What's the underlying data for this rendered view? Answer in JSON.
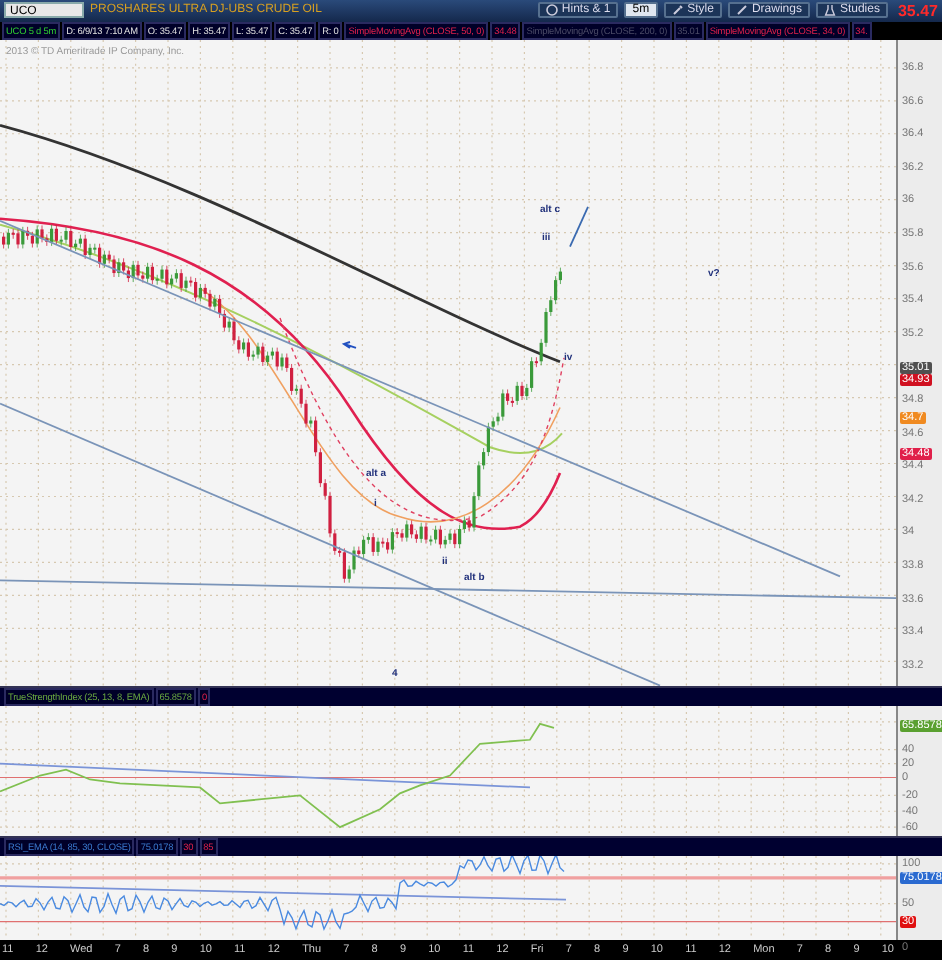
{
  "toolbar": {
    "symbol": "UCO",
    "description": "PROSHARES ULTRA DJ-UBS CRUDE OIL",
    "buttons": [
      {
        "label": "Hints & 1"
      },
      {
        "label": "5m",
        "selected": true
      },
      {
        "label": "Style",
        "selected": false
      },
      {
        "label": "Drawings",
        "selected": false
      },
      {
        "label": "Studies",
        "selected": false
      }
    ],
    "last_price": "35.47"
  },
  "legend": [
    {
      "text": "UCO 5 d 5m",
      "kind": "symbol"
    },
    {
      "text": "D: 6/9/13 7:10 AM",
      "kind": "plain"
    },
    {
      "text": "O: 35.47",
      "kind": "plain"
    },
    {
      "text": "H: 35.47",
      "kind": "plain"
    },
    {
      "text": "L: 35.47",
      "kind": "plain"
    },
    {
      "text": "C: 35.47",
      "kind": "plain"
    },
    {
      "text": "R: 0",
      "kind": "plain"
    },
    {
      "text": "SimpleMovingAvg (CLOSE, 50, 0)",
      "kind": "red"
    },
    {
      "text": "34.48",
      "kind": "red"
    },
    {
      "text": "SimpleMovingAvg (CLOSE, 200, 0)",
      "kind": "dark"
    },
    {
      "text": "35.01",
      "kind": "dark"
    },
    {
      "text": "SimpleMovingAvg (CLOSE, 34, 0)",
      "kind": "red"
    },
    {
      "text": "34.",
      "kind": "red"
    }
  ],
  "price_chart": {
    "copyright": "2013 © TD Ameritrade IP Company, Inc.",
    "wave_labels": [
      "alt c",
      "iii",
      "v?",
      "iv",
      "alt a",
      "i",
      "ii",
      "alt b",
      "4"
    ],
    "axis_ticks": [
      "36.8",
      "36.6",
      "36.4",
      "36.2",
      "36",
      "35.8",
      "35.6",
      "35.4",
      "35.2",
      "34.8",
      "34.6",
      "34.4",
      "34.2",
      "34",
      "33.8",
      "33.6",
      "33.4",
      "33.2"
    ],
    "price_badges": [
      {
        "text": "35.01",
        "color": "#505050"
      },
      {
        "text": "34.93",
        "color": "#d01020"
      },
      {
        "text": "34.7",
        "color": "#f08a20"
      },
      {
        "text": "34.48",
        "color": "#e0204a"
      }
    ]
  },
  "tsi_panel": {
    "legend": [
      {
        "text": "TrueStrengthIndex (25, 13, 8, EMA)",
        "kind": "green"
      },
      {
        "text": "65.8578",
        "kind": "green"
      },
      {
        "text": "0",
        "kind": "red"
      }
    ],
    "axis_ticks": [
      "40",
      "20",
      "0",
      "-20",
      "-40",
      "-60"
    ],
    "badges": [
      {
        "text": "65.8578",
        "color": "#5aa030"
      }
    ]
  },
  "rsi_panel": {
    "legend": [
      {
        "text": "RSI_EMA (14, 85, 30, CLOSE)",
        "kind": "blue"
      },
      {
        "text": "75.0178",
        "kind": "blue"
      },
      {
        "text": "30",
        "kind": "red"
      },
      {
        "text": "85",
        "kind": "red"
      }
    ],
    "axis_ticks": [
      "100",
      "50",
      "0"
    ],
    "badges": [
      {
        "text": "75.0178",
        "color": "#2a6ad0"
      },
      {
        "text": "30",
        "color": "#e01010"
      }
    ]
  },
  "time_axis": [
    "11",
    "12",
    "Wed",
    "7",
    "8",
    "9",
    "10",
    "11",
    "12",
    "Thu",
    "7",
    "8",
    "9",
    "10",
    "11",
    "12",
    "Fri",
    "7",
    "8",
    "9",
    "10",
    "11",
    "12",
    "Mon",
    "7",
    "8",
    "9",
    "10"
  ]
}
